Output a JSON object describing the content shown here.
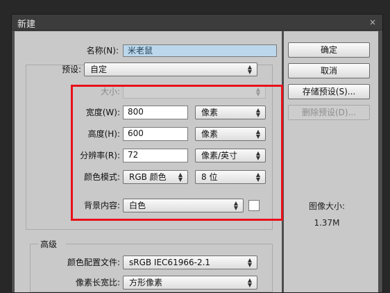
{
  "window": {
    "title": "新建",
    "close_glyph": "×"
  },
  "form": {
    "name_label": "名称(N):",
    "name_value": "米老鼠",
    "preset_label": "预设:",
    "preset_value": "自定",
    "size_label": "大小:",
    "size_value": "",
    "width_label": "宽度(W):",
    "width_value": "800",
    "width_unit": "像素",
    "height_label": "高度(H):",
    "height_value": "600",
    "height_unit": "像素",
    "resolution_label": "分辨率(R):",
    "resolution_value": "72",
    "resolution_unit": "像素/英寸",
    "color_mode_label": "颜色模式:",
    "color_mode_value": "RGB 颜色",
    "bit_depth_value": "8 位",
    "background_label": "背景内容:",
    "background_value": "白色",
    "background_swatch_color": "#ffffff"
  },
  "advanced": {
    "heading": "高级",
    "color_profile_label": "颜色配置文件:",
    "color_profile_value": "sRGB IEC61966-2.1",
    "pixel_aspect_label": "像素长宽比:",
    "pixel_aspect_value": "方形像素"
  },
  "buttons": {
    "ok": "确定",
    "cancel": "取消",
    "save_preset": "存储预设(S)...",
    "delete_preset": "删除预设(D)..."
  },
  "image_size": {
    "label": "图像大小:",
    "value": "1.37M"
  },
  "colors": {
    "highlight_box": "#e8101a",
    "panel": "#c9c9c9",
    "title_bar": "#3c3c3c"
  }
}
